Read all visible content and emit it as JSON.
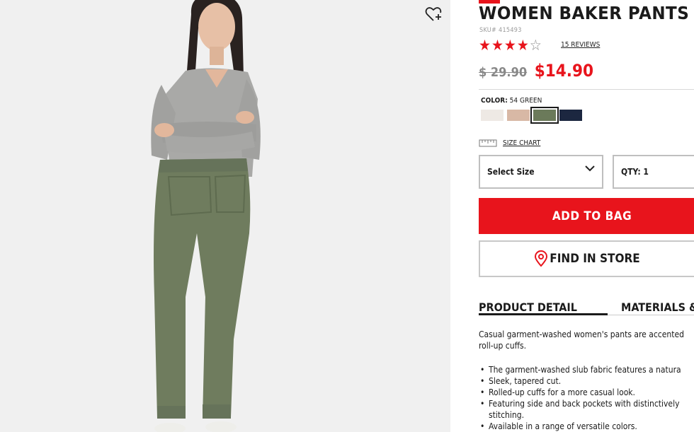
{
  "product": {
    "title": "WOMEN BAKER PANTS",
    "sku": "SKU# 415493",
    "rating": 4,
    "rating_max": 5,
    "reviews_label": "15 REVIEWS",
    "old_price": "$ 29.90",
    "sale_price": "$14.90",
    "color_label": "COLOR:",
    "color_value": "54 GREEN",
    "swatches": [
      {
        "name": "off-white",
        "color": "#eee9e4"
      },
      {
        "name": "beige",
        "color": "#d8b8a5"
      },
      {
        "name": "green",
        "color": "#6b7a5a",
        "selected": true
      },
      {
        "name": "navy",
        "color": "#1c2740"
      }
    ]
  },
  "controls": {
    "size_chart_label": "SIZE CHART",
    "select_size_label": "Select Size",
    "qty_label": "QTY: 1",
    "add_to_bag_label": "ADD TO BAG",
    "find_in_store_label": "FIND IN STORE"
  },
  "tabs": [
    {
      "label": "PRODUCT DETAIL",
      "active": true
    },
    {
      "label": "MATERIALS &",
      "active": false
    }
  ],
  "detail": {
    "description_line1": "Casual garment-washed women's pants are accented",
    "description_line2": "roll-up cuffs.",
    "bullets": [
      "The garment-washed slub fabric features a natura",
      "Sleek, tapered cut.",
      "Rolled-up cuffs for a more casual look.",
      "Featuring side and back pockets with distinctively",
      "stitching.",
      "Available in a range of versatile colors."
    ]
  },
  "colors": {
    "accent_red": "#e8141c",
    "sale_red": "#e8141c",
    "text": "#1b1b1b",
    "pants_green": "#6f7c5e",
    "sweater_gray": "#a9a9a7"
  },
  "icons": {
    "wishlist": "heart-plus-icon",
    "location": "map-pin-icon",
    "size_chart": "ruler-icon",
    "dropdown": "chevron-down-icon"
  }
}
